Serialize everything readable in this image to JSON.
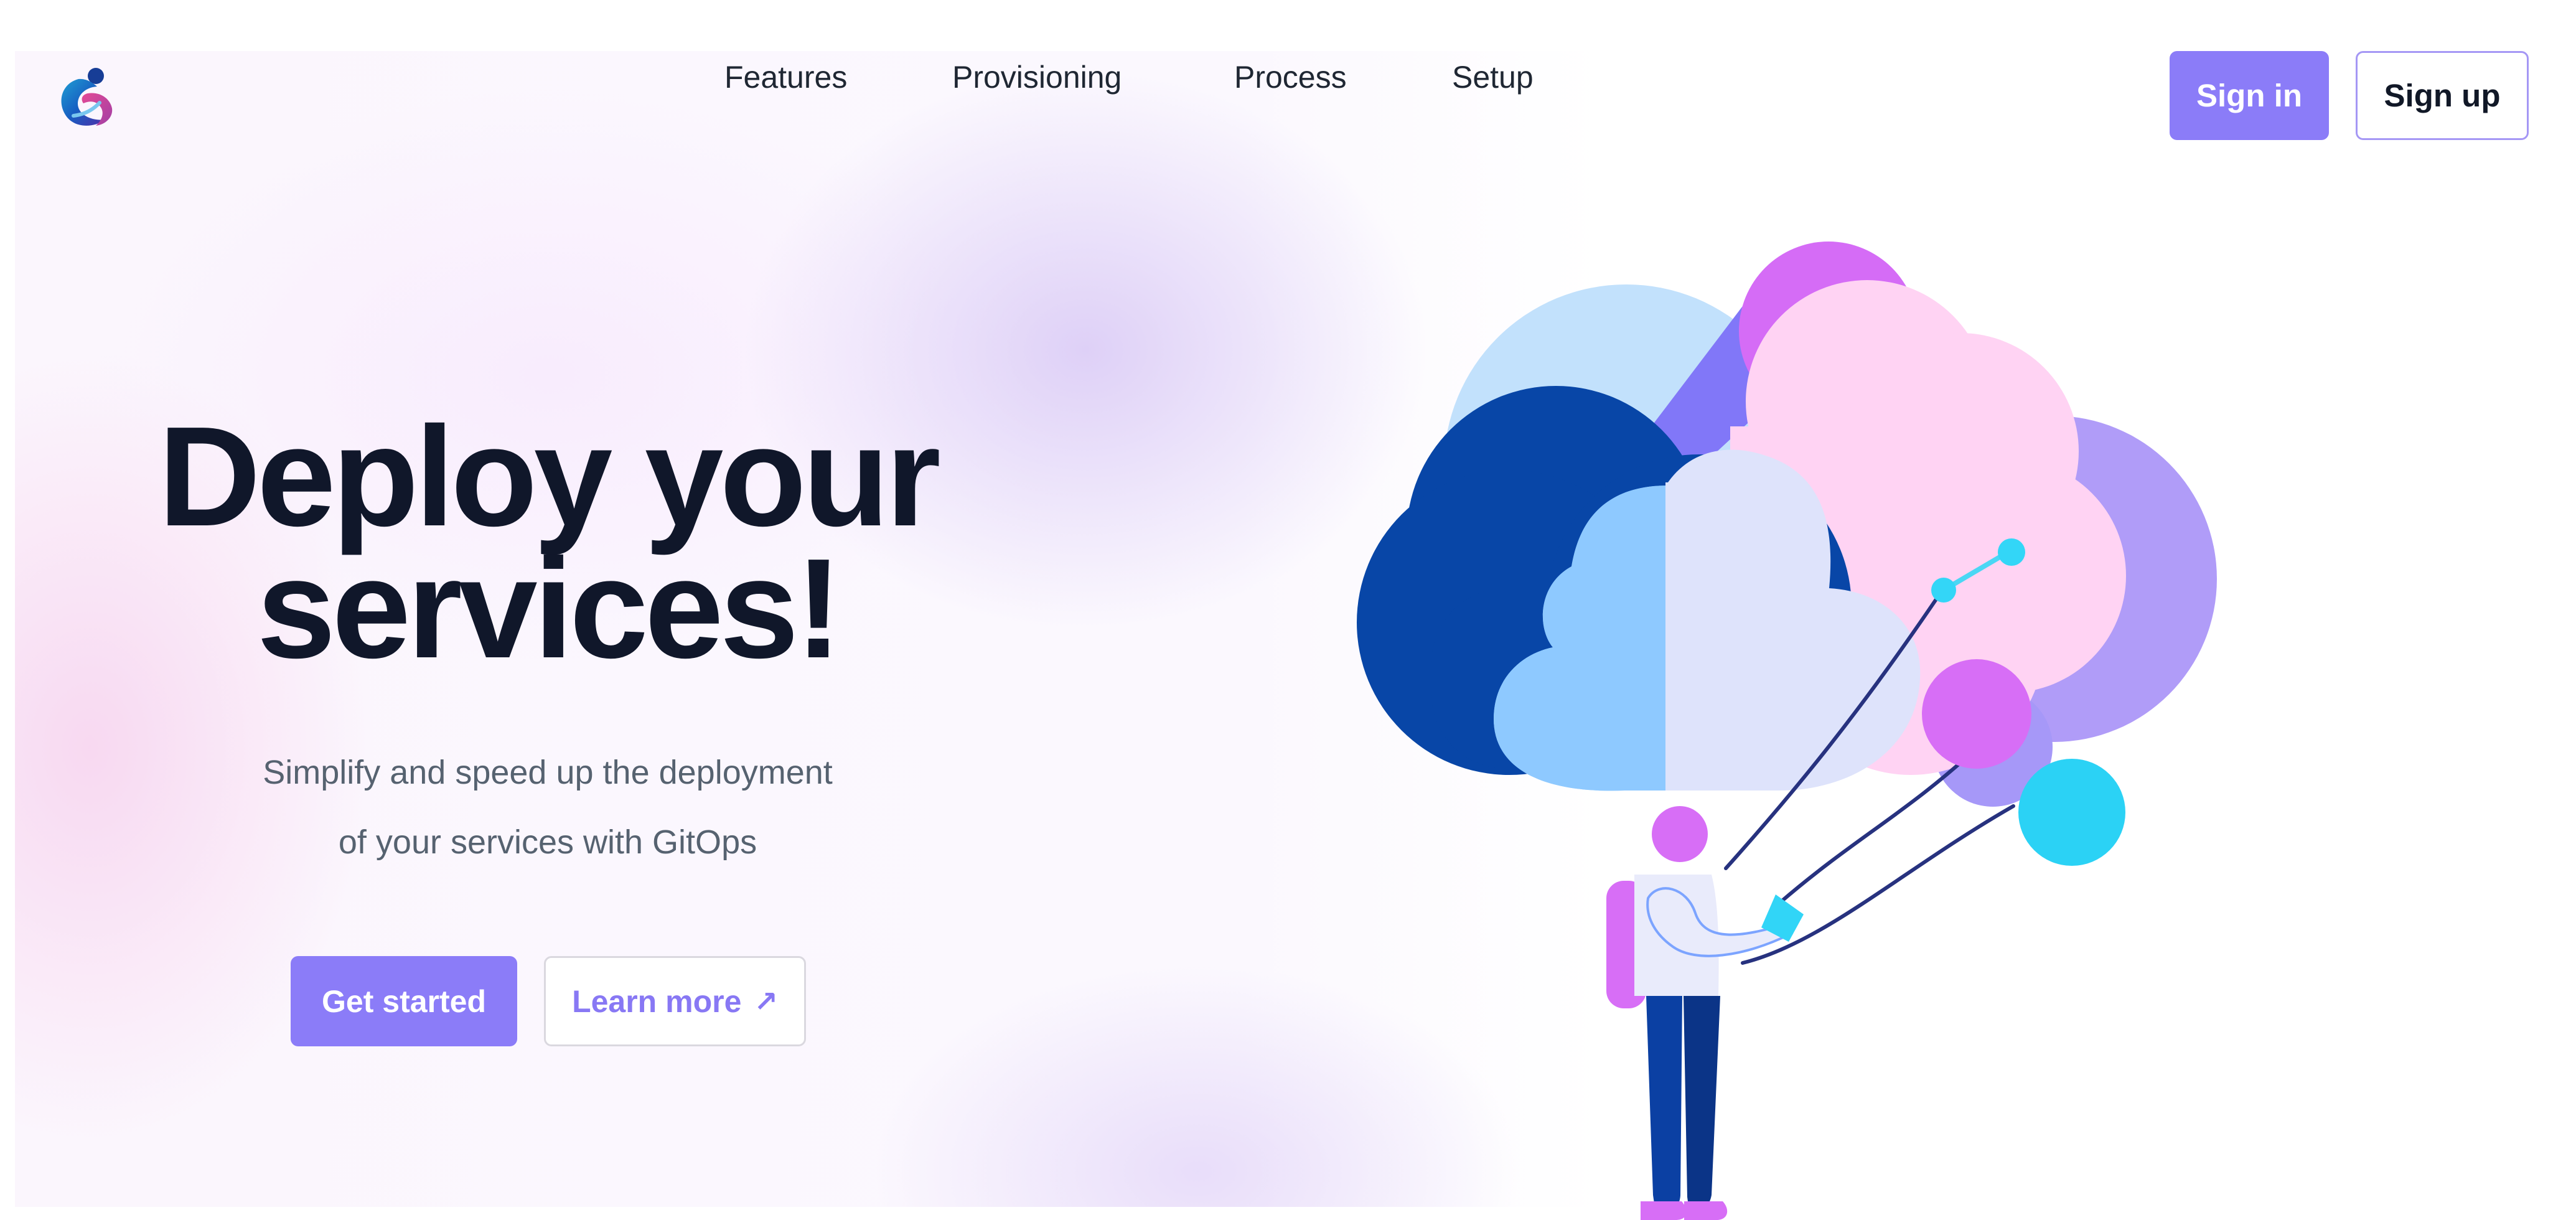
{
  "header": {
    "logo_icon": "abstract-figure-logo-icon",
    "nav": [
      {
        "label": "Features"
      },
      {
        "label": "Provisioning"
      },
      {
        "label": "Process"
      },
      {
        "label": "Setup"
      }
    ],
    "sign_in_label": "Sign in",
    "sign_up_label": "Sign up"
  },
  "hero": {
    "title_line_1": "Deploy your",
    "title_line_2": "services!",
    "subtitle_line_1": "Simplify and speed up the deployment",
    "subtitle_line_2": "of your services with GitOps",
    "primary_cta_label": "Get started",
    "secondary_cta_label": "Learn more",
    "secondary_cta_icon": "arrow-up-right-icon"
  },
  "illustration": {
    "subject": "person-holding-cloud-balloons-illustration"
  },
  "colors": {
    "accent": "#8B7CF8",
    "text_primary": "#10172A",
    "text_secondary": "#566270",
    "button_border": "#A597F5"
  }
}
